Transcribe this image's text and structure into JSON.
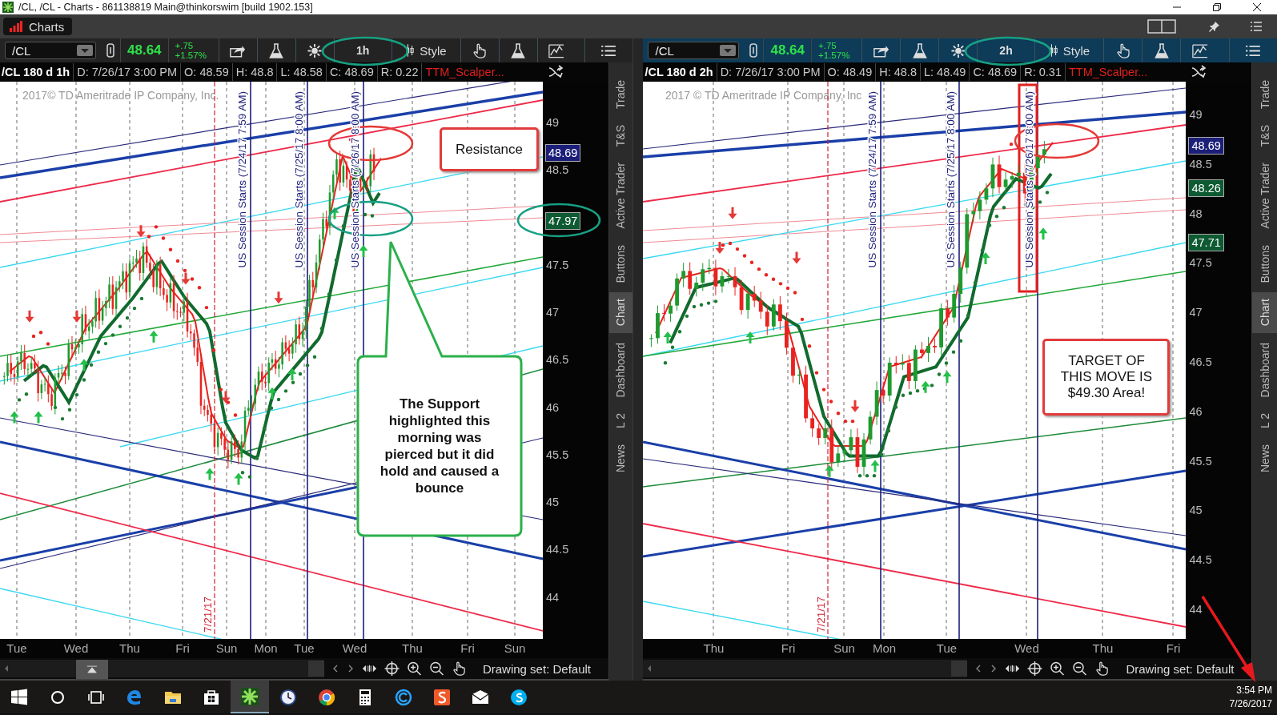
{
  "window": {
    "title": "/CL, /CL - Charts - 861138819 Main@thinkorswim [build 1902.153]"
  },
  "tab": {
    "label": "Charts",
    "selected": true
  },
  "panels": [
    {
      "active": false,
      "symbol": "/CL",
      "last": "48.64",
      "change": "+.75",
      "change_pct": "+1.57%",
      "aggregation": "1h",
      "style_label": "Style",
      "info": [
        "/CL 180 d 1h",
        "D: 7/26/17 3:00 PM",
        "O: 48.59",
        "H: 48.8",
        "L: 48.58",
        "C: 48.69",
        "R: 0.22",
        "TTM_Scalper..."
      ],
      "copyright": "2017© TD Ameritrade IP Company, Inc.",
      "sessions": [
        {
          "label": "US Session Starts (7/24/17 7:59 AM)",
          "highlighted": false
        },
        {
          "label": "US Session Starts (7/25/17 8:00 AM)",
          "highlighted": false
        },
        {
          "label": "US Session Starts (7/26/17 8:00 AM)",
          "highlighted": false
        }
      ],
      "date_label": "7/21/17",
      "price_ticks": [
        "49",
        "48.5",
        "47.5",
        "47",
        "46.5",
        "46",
        "45.5",
        "45",
        "44.5",
        "44"
      ],
      "price_badges": [
        {
          "value": "48.69",
          "color": "#1c1f78"
        },
        {
          "value": "47.97",
          "color": "#0e5a32"
        }
      ],
      "time_labels": [
        "Tue",
        "Wed",
        "Thu",
        "Fri",
        "Sun",
        "Mon",
        "Tue",
        "Wed",
        "Thu",
        "Fri",
        "Sun"
      ],
      "notes": [
        {
          "kind": "box",
          "text": "Resistance"
        },
        {
          "kind": "callout",
          "text": "The Support highlighted this morning was pierced but it did hold and caused a bounce"
        }
      ],
      "collapse_tab": true,
      "drawing_set": "Drawing set: Default",
      "sidebar_tabs": [
        {
          "label": "Trade",
          "selected": false
        },
        {
          "label": "T&S",
          "selected": false
        },
        {
          "label": "Active Trader",
          "selected": false
        },
        {
          "label": "Buttons",
          "selected": false
        },
        {
          "label": "Chart",
          "selected": true
        },
        {
          "label": "Dashboard",
          "selected": false
        },
        {
          "label": "L 2",
          "selected": false
        },
        {
          "label": "News",
          "selected": false
        }
      ]
    },
    {
      "active": true,
      "symbol": "/CL",
      "last": "48.64",
      "change": "+.75",
      "change_pct": "+1.57%",
      "aggregation": "2h",
      "style_label": "Style",
      "info": [
        "/CL 180 d 2h",
        "D: 7/26/17 3:00 PM",
        "O: 48.49",
        "H: 48.8",
        "L: 48.49",
        "C: 48.69",
        "R: 0.31",
        "TTM_Scalper..."
      ],
      "copyright": "2017 © TD Ameritrade IP Company, Inc",
      "sessions": [
        {
          "label": "US Session Starts (7/24/17 7:59 AM)",
          "highlighted": false
        },
        {
          "label": "US Session Starts (7/25/17 8:00 AM)",
          "highlighted": false
        },
        {
          "label": "US Session Starts (7/26/17 8:00 AM)",
          "highlighted": true
        }
      ],
      "date_label": "7/21/17",
      "price_ticks": [
        "49",
        "48.5",
        "48",
        "47.5",
        "47",
        "46.5",
        "46",
        "45.5",
        "45",
        "44.5",
        "44"
      ],
      "price_badges": [
        {
          "value": "48.69",
          "color": "#1c1f78"
        },
        {
          "value": "48.26",
          "color": "#0e5a32"
        },
        {
          "value": "47.71",
          "color": "#0e5a32"
        }
      ],
      "time_labels": [
        "Thu",
        "Fri",
        "Sun",
        "Mon",
        "Tue",
        "Wed",
        "Thu",
        "Fri"
      ],
      "notes": [
        {
          "kind": "box",
          "text": "TARGET OF THIS MOVE IS $49.30 Area!"
        }
      ],
      "collapse_tab": false,
      "drawing_set": "Drawing set: Default",
      "sidebar_tabs": [
        {
          "label": "Trade",
          "selected": false
        },
        {
          "label": "T&S",
          "selected": false
        },
        {
          "label": "Active Trader",
          "selected": false
        },
        {
          "label": "Buttons",
          "selected": false
        },
        {
          "label": "Chart",
          "selected": true
        },
        {
          "label": "Dashboard",
          "selected": false
        },
        {
          "label": "L 2",
          "selected": false
        },
        {
          "label": "News",
          "selected": false
        }
      ]
    }
  ],
  "taskbar": {
    "apps": [
      {
        "active": false
      },
      {
        "active": false
      },
      {
        "active": false
      },
      {
        "active": false
      },
      {
        "active": false
      },
      {
        "active": false
      },
      {
        "active": true
      },
      {
        "active": false
      },
      {
        "active": false
      },
      {
        "active": false
      },
      {
        "active": false
      },
      {
        "active": false
      },
      {
        "active": false
      },
      {
        "active": false
      }
    ],
    "time": "3:54 PM",
    "date": "7/26/2017"
  }
}
